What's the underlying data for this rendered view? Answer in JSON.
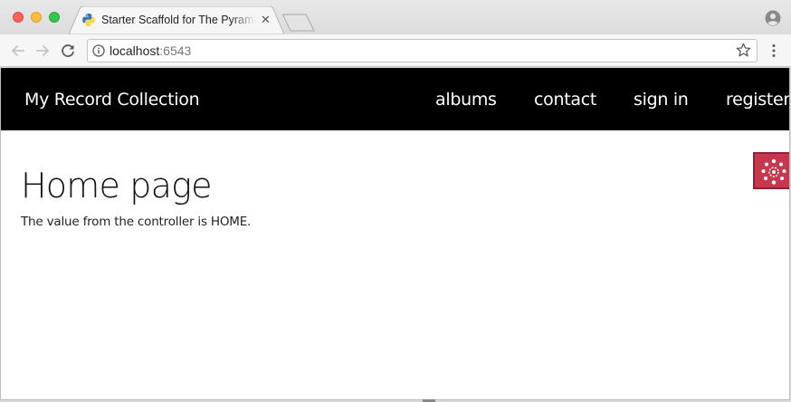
{
  "browser": {
    "tab": {
      "title": "Starter Scaffold for The Pyramid Web Framework",
      "favicon": "python-icon",
      "close_label": "✕"
    },
    "address": {
      "host": "localhost",
      "port": ":6543"
    },
    "icons": {
      "back": "back-arrow-icon",
      "forward": "forward-arrow-icon",
      "reload": "reload-icon",
      "info": "info-icon",
      "bookmark": "star-icon",
      "menu": "kebab-menu-icon",
      "profile": "profile-icon"
    }
  },
  "site": {
    "brand": "My Record Collection",
    "nav": [
      {
        "label": "albums"
      },
      {
        "label": "contact"
      },
      {
        "label": "sign in"
      },
      {
        "label": "register"
      }
    ]
  },
  "main": {
    "heading": "Home page",
    "text": "The value from the controller is HOME."
  },
  "debug_toolbar": {
    "icon": "pyramid-debug-toolbar-icon",
    "color": "#c7384f"
  },
  "colors": {
    "navbar_bg": "#000000",
    "page_bg": "#ffffff",
    "debug_bg": "#c7384f"
  }
}
